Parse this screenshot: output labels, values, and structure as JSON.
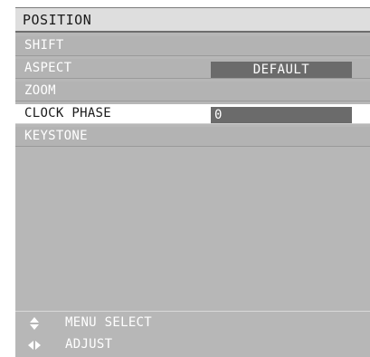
{
  "menu_title": "POSITION",
  "items": [
    {
      "label": "SHIFT"
    },
    {
      "label": "ASPECT",
      "value": "DEFAULT"
    },
    {
      "label": "ZOOM"
    },
    {
      "label": "CLOCK PHASE",
      "value": "0"
    },
    {
      "label": "KEYSTONE"
    }
  ],
  "selected_item": "CLOCK PHASE",
  "footer": {
    "menu_select": "MENU SELECT",
    "adjust": "ADJUST",
    "menu_select_icon": "up-down-arrows-icon",
    "adjust_icon": "left-right-arrows-icon"
  },
  "colors": {
    "panel": "#b7b7b7",
    "title_bar": "#dedede",
    "selected_row": "#ffffff",
    "value_box": "#6b6b6b",
    "text_light": "#ffffff",
    "text_dark": "#1a1a1a"
  }
}
